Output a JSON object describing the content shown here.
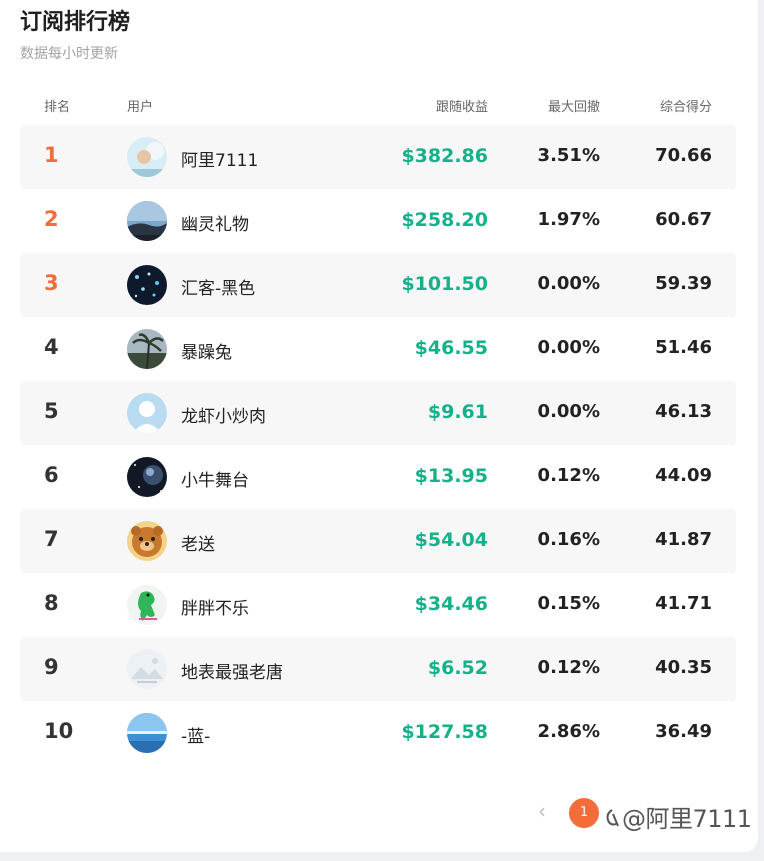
{
  "title": "订阅排行榜",
  "subtitle": "数据每小时更新",
  "columns": {
    "rank": "排名",
    "user": "用户",
    "gain": "跟随收益",
    "drawdown": "最大回撤",
    "score": "综合得分"
  },
  "rows": [
    {
      "rank": "1",
      "user": "阿里7111",
      "gain": "$382.86",
      "drawdown": "3.51%",
      "score": "70.66",
      "avatar": "avatar-child-icon"
    },
    {
      "rank": "2",
      "user": "幽灵礼物",
      "gain": "$258.20",
      "drawdown": "1.97%",
      "score": "60.67",
      "avatar": "avatar-sky-icon"
    },
    {
      "rank": "3",
      "user": "汇客-黑色",
      "gain": "$101.50",
      "drawdown": "0.00%",
      "score": "59.39",
      "avatar": "avatar-lights-icon"
    },
    {
      "rank": "4",
      "user": "暴躁兔",
      "gain": "$46.55",
      "drawdown": "0.00%",
      "score": "51.46",
      "avatar": "avatar-palm-icon"
    },
    {
      "rank": "5",
      "user": "龙虾小炒肉",
      "gain": "$9.61",
      "drawdown": "0.00%",
      "score": "46.13",
      "avatar": "avatar-default-icon"
    },
    {
      "rank": "6",
      "user": "小牛舞台",
      "gain": "$13.95",
      "drawdown": "0.12%",
      "score": "44.09",
      "avatar": "avatar-planet-icon"
    },
    {
      "rank": "7",
      "user": "老送",
      "gain": "$54.04",
      "drawdown": "0.16%",
      "score": "41.87",
      "avatar": "avatar-bear-icon"
    },
    {
      "rank": "8",
      "user": "胖胖不乐",
      "gain": "$34.46",
      "drawdown": "0.15%",
      "score": "41.71",
      "avatar": "avatar-dino-icon"
    },
    {
      "rank": "9",
      "user": "地表最强老唐",
      "gain": "$6.52",
      "drawdown": "0.12%",
      "score": "40.35",
      "avatar": "avatar-placeholder-icon"
    },
    {
      "rank": "10",
      "user": "-蓝-",
      "gain": "$127.58",
      "drawdown": "2.86%",
      "score": "36.49",
      "avatar": "avatar-sea-icon"
    }
  ],
  "pagination": {
    "prev_icon": "chevron-left-icon",
    "current_page": "1"
  },
  "watermark": "@阿里7111",
  "colors": {
    "accent": "#f46c3a",
    "gain": "#16b08a",
    "row_alt": "#f7f7f7"
  }
}
